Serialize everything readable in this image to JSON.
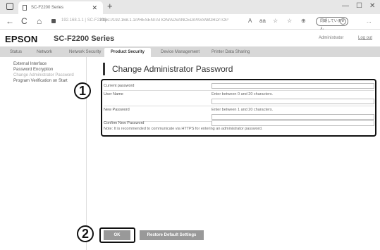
{
  "browser": {
    "tab_title": "SC-F2200 Series",
    "tab_close": "✕",
    "new_tab": "+",
    "window_controls": [
      "—",
      "☐",
      "✕"
    ],
    "nav_icons": [
      "←",
      "C",
      "⌂"
    ],
    "site_text": "192.168.1.1 | SC-F2200",
    "url": "https://192.168.1.1/PRESENTATION/ADVANCED/PASSWORD/TOP",
    "toolbar_icons": [
      "A",
      "aa",
      "☆",
      "☆",
      "⊕",
      "..."
    ],
    "profile_label": "同期していません"
  },
  "app": {
    "logo": "EPSON",
    "model": "SC-F2200 Series",
    "user": "Administrator",
    "logout": "Log out",
    "tabs": [
      "Status",
      "Network",
      "Network Security",
      "Product Security",
      "Device Management",
      "Printer Data Sharing"
    ],
    "active_tab": "Product Security"
  },
  "sidebar": {
    "items": [
      {
        "label": "External Interface",
        "dim": false
      },
      {
        "label": "Password Encryption",
        "dim": false
      },
      {
        "label": "Change Administrator Password",
        "dim": true
      },
      {
        "label": "Program Verification on Start",
        "dim": false
      }
    ]
  },
  "main": {
    "title": "Change Administrator Password",
    "fields": [
      {
        "label": "Current password",
        "hint": ""
      },
      {
        "label": "User Name",
        "hint": "Enter between 0 and 20 characters."
      },
      {
        "label": "New Password",
        "hint": "Enter between 1 and 20 characters."
      },
      {
        "label": "Confirm New Password",
        "hint": ""
      }
    ],
    "note": "Note: It is recommended to communicate via HTTPS for entering an administrator password."
  },
  "buttons": {
    "ok": "OK",
    "restore": "Restore Default Settings"
  },
  "callouts": [
    "1",
    "2"
  ]
}
